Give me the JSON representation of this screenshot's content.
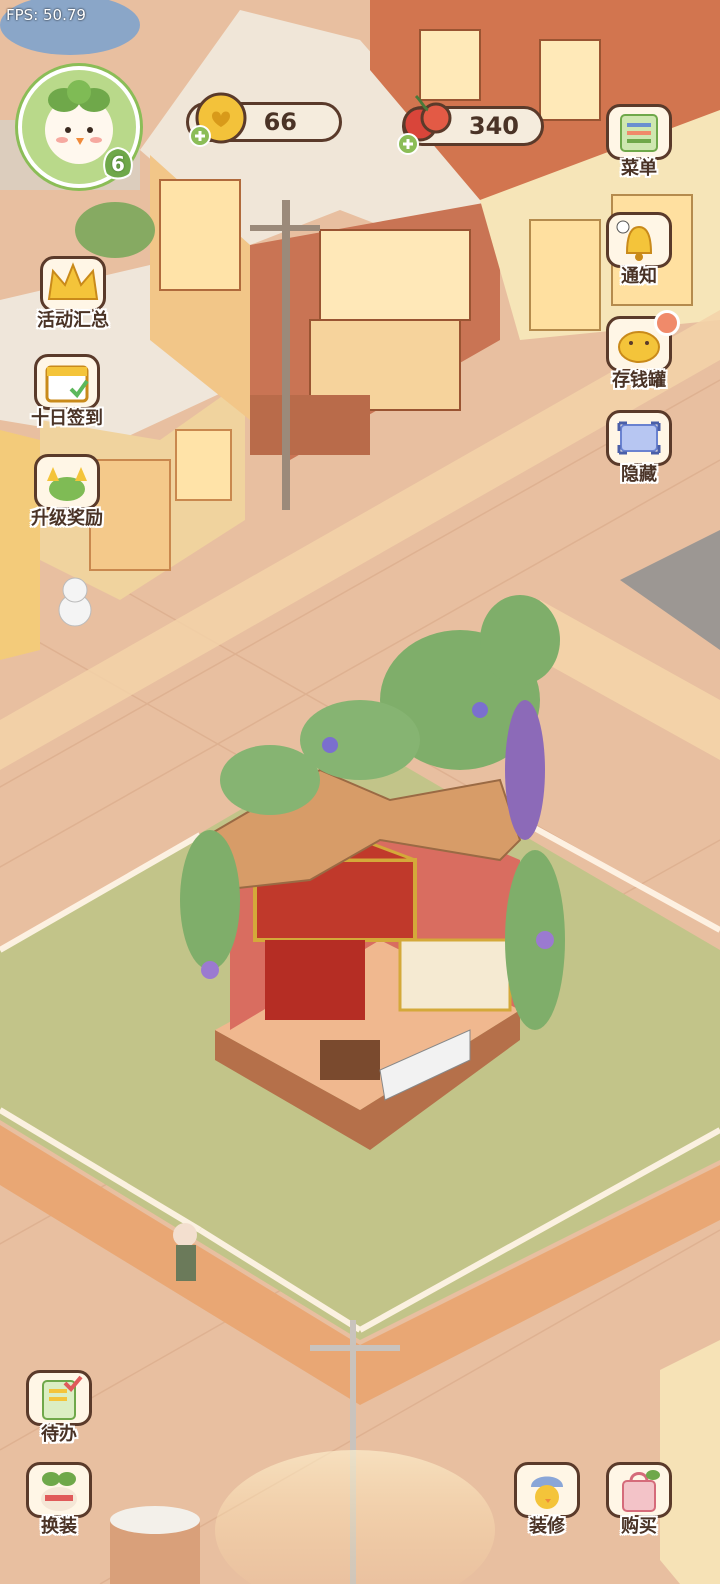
{
  "hud": {
    "fps": "FPS: 50.79",
    "level": "6",
    "coins": "66",
    "berries": "340"
  },
  "left_menu": [
    {
      "label": "活动汇总"
    },
    {
      "label": "十日签到"
    },
    {
      "label": "升级奖励"
    }
  ],
  "right_menu": [
    {
      "label": "菜单"
    },
    {
      "label": "通知"
    },
    {
      "label": "存钱罐"
    },
    {
      "label": "隐藏"
    }
  ],
  "bottom_left": [
    {
      "label": "待办"
    },
    {
      "label": "换装"
    }
  ],
  "bottom_right": [
    {
      "label": "装修"
    },
    {
      "label": "购买"
    }
  ],
  "colors": {
    "road": "#e8bfa0",
    "lawn": "#c2c489",
    "outline": "#5a3a2a",
    "accent_green": "#8bbd57"
  }
}
